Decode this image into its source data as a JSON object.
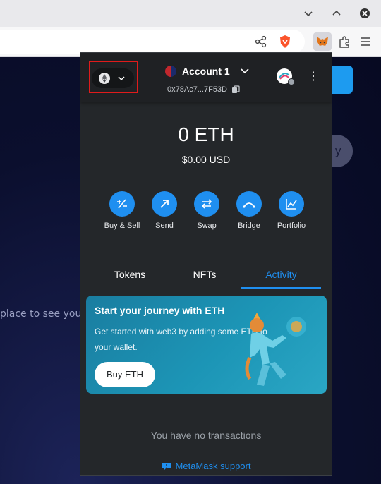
{
  "page": {
    "background_text": "place to see your",
    "pill_text": "y"
  },
  "metamask": {
    "account": {
      "name": "Account 1",
      "address": "0x78Ac7...7F53D"
    },
    "balance": {
      "eth": "0 ETH",
      "usd": "$0.00 USD"
    },
    "actions": [
      {
        "label": "Buy & Sell",
        "icon": "plus-minus-icon"
      },
      {
        "label": "Send",
        "icon": "arrow-up-right-icon"
      },
      {
        "label": "Swap",
        "icon": "swap-arrows-icon"
      },
      {
        "label": "Bridge",
        "icon": "bridge-icon"
      },
      {
        "label": "Portfolio",
        "icon": "chart-icon"
      }
    ],
    "tabs": [
      {
        "label": "Tokens",
        "active": false
      },
      {
        "label": "NFTs",
        "active": false
      },
      {
        "label": "Activity",
        "active": true
      }
    ],
    "banner": {
      "title": "Start your journey with ETH",
      "body": "Get started with web3 by adding some ETH to your wallet.",
      "button": "Buy ETH"
    },
    "empty_state": "You have no transactions",
    "support_link": "MetaMask support"
  },
  "colors": {
    "accent": "#1f8ff0",
    "popup_bg": "#24272a",
    "highlight": "#e01b1b"
  }
}
